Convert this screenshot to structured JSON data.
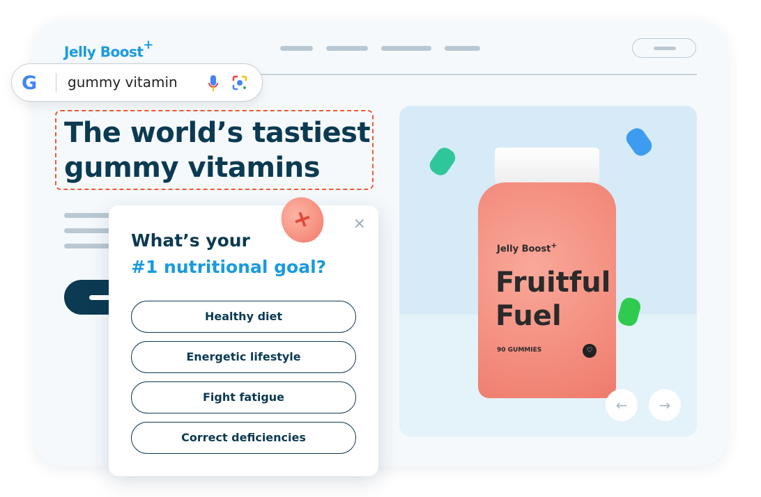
{
  "header": {
    "logo": "Jelly Boost",
    "logo_mark": "+"
  },
  "search": {
    "query": "gummy vitamin",
    "google_mark": "G",
    "mic_icon": "mic-icon",
    "lens_icon": "lens-icon"
  },
  "hero": {
    "headline_line1": "The world’s tastiest",
    "headline_line2": "gummy vitamins"
  },
  "popup": {
    "question_line1": "What’s your",
    "question_line2": "#1 nutritional goal?",
    "close": "×",
    "options": [
      "Healthy diet",
      "Energetic lifestyle",
      "Fight fatigue",
      "Correct deficiencies"
    ]
  },
  "product": {
    "brand": "Jelly Boost",
    "brand_mark": "+",
    "name_line1": "Fruitful",
    "name_line2": "Fuel",
    "count": "90 GUMMIES"
  },
  "carousel": {
    "prev": "←",
    "next": "→"
  },
  "colors": {
    "brand_blue": "#1a9ae0",
    "navy": "#0b3a52",
    "highlight": "#ee5a2f"
  }
}
